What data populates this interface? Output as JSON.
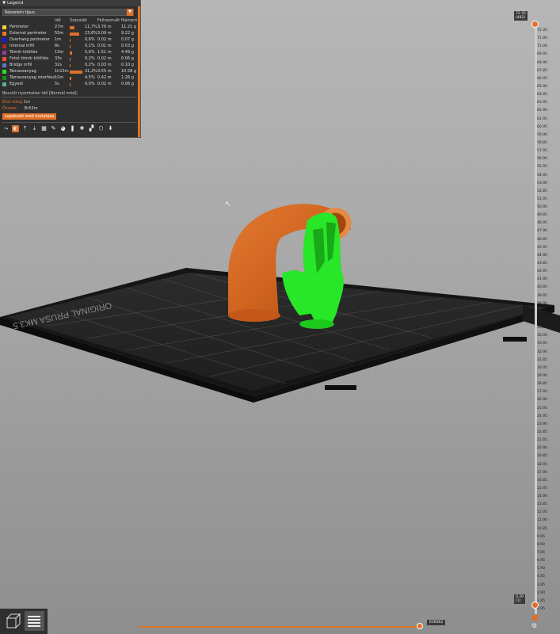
{
  "legend": {
    "title": "Legend",
    "view_type": "Részelem típus",
    "columns": {
      "time": "Idő",
      "percent": "Százalék",
      "used_filament": "Felhasznált filament"
    },
    "items": [
      {
        "name": "Perimeter",
        "time": "27m",
        "percent": "11,7%",
        "length": "3.76 m",
        "weight": "11.21 g",
        "color": "#f0d23c",
        "bar": 0.117
      },
      {
        "name": "External perimeter",
        "time": "55m",
        "percent": "23,6%",
        "length": "3.09 m",
        "weight": "9.22 g",
        "color": "#f07828",
        "bar": 0.236
      },
      {
        "name": "Overhang perimeter",
        "time": "1m",
        "percent": "0,6%",
        "length": "0.02 m",
        "weight": "0.07 g",
        "color": "#1a1ae6",
        "bar": 0.006
      },
      {
        "name": "Internal infill",
        "time": "8s",
        "percent": "0,1%",
        "length": "0.01 m",
        "weight": "0.03 g",
        "color": "#b02a2a",
        "bar": 0.001
      },
      {
        "name": "Tömör kitöltés",
        "time": "13m",
        "percent": "5,6%",
        "length": "1.51 m",
        "weight": "4.49 g",
        "color": "#9a3aa0",
        "bar": 0.056
      },
      {
        "name": "Felső tömör kitöltés",
        "time": "33s",
        "percent": "0,2%",
        "length": "0.02 m",
        "weight": "0.06 g",
        "color": "#e8503c",
        "bar": 0.002
      },
      {
        "name": "Bridge infill",
        "time": "32s",
        "percent": "0,2%",
        "length": "0.03 m",
        "weight": "0.10 g",
        "color": "#5a78c8",
        "bar": 0.002
      },
      {
        "name": "Támaszanyag",
        "time": "1h13m",
        "percent": "31,2%",
        "length": "3.55 m",
        "weight": "10.58 g",
        "color": "#22e622",
        "bar": 0.312
      },
      {
        "name": "Támaszanyag interfész",
        "time": "10m",
        "percent": "4,5%",
        "length": "0.42 m",
        "weight": "1.26 g",
        "color": "#1a8c1a",
        "bar": 0.045
      },
      {
        "name": "Egyedi",
        "time": "5s",
        "percent": "0,0%",
        "length": "0.02 m",
        "weight": "0.06 g",
        "color": "#5ab48c",
        "bar": 0.0
      }
    ],
    "estimate_label": "Becsült nyomtatási idő [Normál mód]:",
    "first_layer_label": "Első réteg:",
    "first_layer_value": "1m",
    "total_label": "Összes:",
    "total_value": "3h53m",
    "show_stealth_button": "Lopakodó mód mutatása"
  },
  "vertical_slider": {
    "top_label_line1": "72.35",
    "top_label_line2": "(482)",
    "bottom_label_line1": "0.20",
    "bottom_label_line2": "(1)",
    "ticks": [
      "72.35",
      "71.90",
      "71.00",
      "69.95",
      "68.90",
      "67.85",
      "66.95",
      "65.90",
      "64.85",
      "63.95",
      "62.90",
      "61.95",
      "60.95",
      "59.90",
      "58.85",
      "57.95",
      "56.90",
      "55.95",
      "54.95",
      "53.90",
      "52.85",
      "51.95",
      "50.90",
      "49.85",
      "48.95",
      "47.90",
      "46.85",
      "45.95",
      "44.90",
      "43.85",
      "42.95",
      "41.90",
      "40.85",
      "39.95",
      "38.90",
      "37.85",
      "36.95",
      "35.90",
      "35.00",
      "33.95",
      "32.90",
      "31.85",
      "30.95",
      "29.90",
      "28.85",
      "27.95",
      "26.90",
      "25.95",
      "24.95",
      "23.90",
      "22.85",
      "21.95",
      "20.90",
      "19.85",
      "18.95",
      "17.90",
      "16.85",
      "15.95",
      "14.90",
      "13.85",
      "12.95",
      "11.90",
      "10.85",
      "9.95",
      "8.90",
      "7.85",
      "6.95",
      "5.90",
      "4.85",
      "3.95",
      "2.90",
      "1.85",
      "0.95"
    ]
  },
  "horizontal_slider": {
    "value": "636062"
  }
}
